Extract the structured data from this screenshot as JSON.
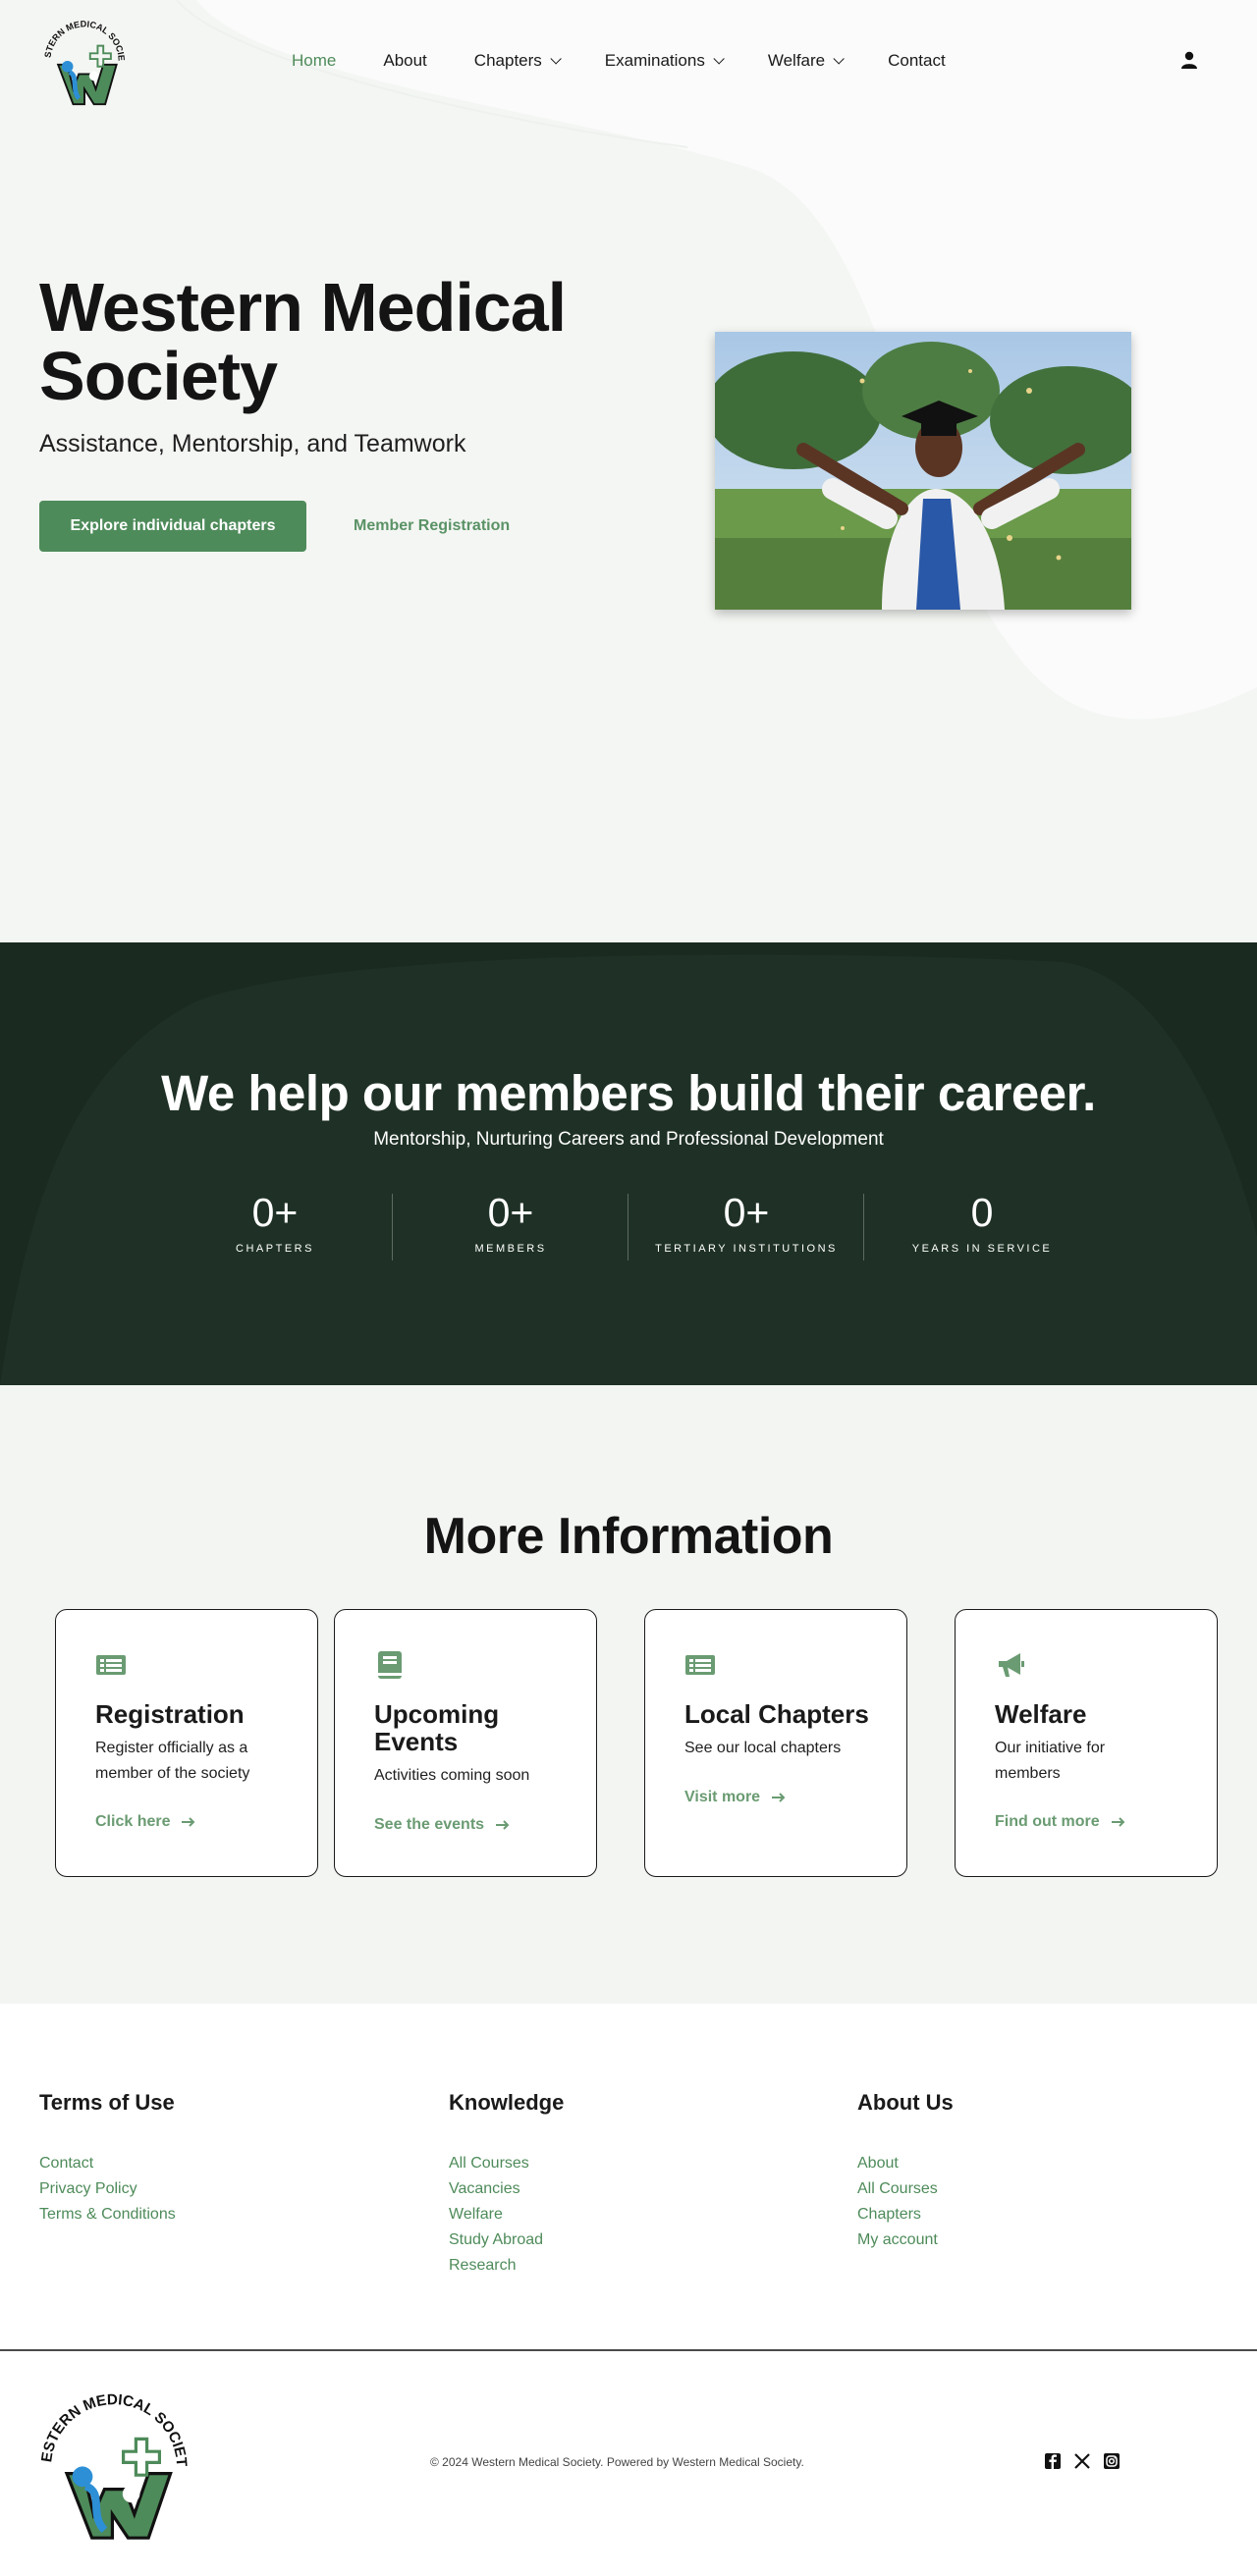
{
  "brand": {
    "name": "Western Medical Society",
    "logo_text": "WESTERN MEDICAL SOCIETY",
    "colors": {
      "primary": "#4e8b5a",
      "dark": "#1a2a20",
      "accent_blue": "#2d8fd6",
      "text": "#1a1a1a"
    }
  },
  "nav": {
    "items": [
      {
        "label": "Home",
        "active": true,
        "dropdown": false
      },
      {
        "label": "About",
        "active": false,
        "dropdown": false
      },
      {
        "label": "Chapters",
        "active": false,
        "dropdown": true
      },
      {
        "label": "Examinations",
        "active": false,
        "dropdown": true
      },
      {
        "label": "Welfare",
        "active": false,
        "dropdown": true
      },
      {
        "label": "Contact",
        "active": false,
        "dropdown": false
      }
    ],
    "account_icon": "user-icon"
  },
  "hero": {
    "title": "Western Medical Society",
    "subtitle": "Assistance, Mentorship, and Teamwork",
    "primary_button": "Explore individual chapters",
    "secondary_button": "Member Registration"
  },
  "stats": {
    "title": "We help our members build their career.",
    "subtitle": "Mentorship, Nurturing Careers and Professional Development",
    "items": [
      {
        "value": "0+",
        "label": "CHAPTERS"
      },
      {
        "value": "0+",
        "label": "MEMBERS"
      },
      {
        "value": "0+",
        "label": "TERTIARY INSTITUTIONS"
      },
      {
        "value": "0",
        "label": "YEARS IN SERVICE"
      }
    ]
  },
  "info": {
    "title": "More Information",
    "cards": [
      {
        "icon": "list-alt-icon",
        "title": "Registration",
        "description": "Register officially as a member of the society",
        "link": "Click here"
      },
      {
        "icon": "book-icon",
        "title": "Upcoming Events",
        "description": "Activities coming soon",
        "link": "See the events"
      },
      {
        "icon": "list-alt-icon",
        "title": "Local Chapters",
        "description": "See our local chapters",
        "link": "Visit more"
      },
      {
        "icon": "megaphone-icon",
        "title": "Welfare",
        "description": "Our initiative for members",
        "link": "Find out more"
      }
    ]
  },
  "footer": {
    "columns": [
      {
        "title": "Terms of Use",
        "links": [
          "Contact",
          "Privacy Policy",
          "Terms & Conditions"
        ]
      },
      {
        "title": "Knowledge",
        "links": [
          "All Courses",
          "Vacancies",
          "Welfare",
          "Study Abroad",
          "Research"
        ]
      },
      {
        "title": "About Us",
        "links": [
          "About",
          "All Courses",
          "Chapters",
          "My account"
        ]
      }
    ],
    "copyright": "© 2024 Western Medical Society. Powered by Western Medical Society.",
    "socials": [
      "facebook-icon",
      "x-icon",
      "instagram-icon"
    ]
  }
}
